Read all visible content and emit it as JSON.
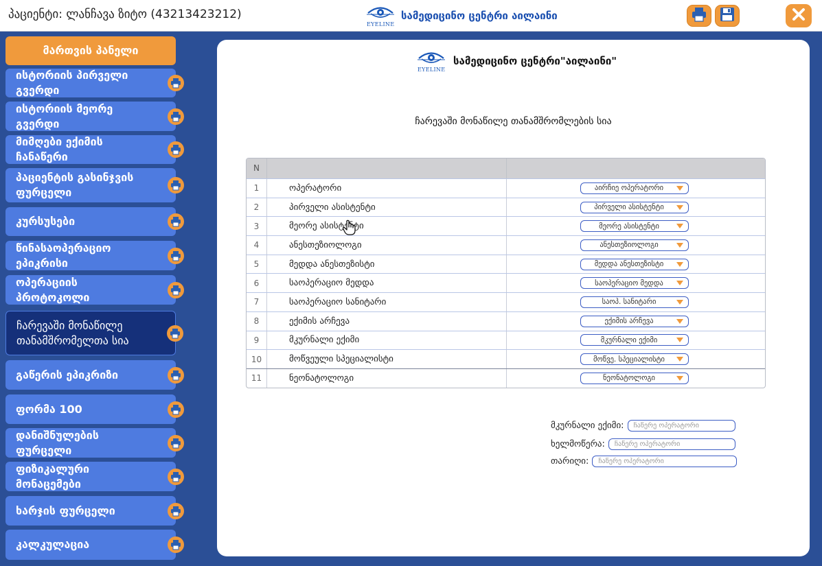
{
  "header": {
    "patient_label": "პაციენტი: ლანჩავა ზიტო (43213423212)",
    "center_name": "სამედიცინო ცენტრი აილაინი",
    "logo_text": "EYELINE"
  },
  "icons": {
    "print": "printer-icon",
    "save": "floppy-disk-icon",
    "close": "close-icon",
    "logo": "eye-logo-icon"
  },
  "colors": {
    "accent": "#f09a3c",
    "sidebar_bg": "#2b4f96",
    "sidebar_item": "#4e7be0",
    "sidebar_selected": "#15307a"
  },
  "sidebar": {
    "items": [
      {
        "label": "მართვის პანელი"
      },
      {
        "label": "ისტორიის პირველი გვერდი"
      },
      {
        "label": "ისტორიის მეორე გვერდი"
      },
      {
        "label": "მიმღები ექიმის ჩანაწერი"
      },
      {
        "label": "პაციენტის გასინჯვის ფურცელი"
      },
      {
        "label": "კურსუსები"
      },
      {
        "label": "წინასაოპერაციო ეპიკრისი"
      },
      {
        "label": "ოპერაციის პროტოკოლი"
      },
      {
        "label": "ჩარევაში მონაწილე თანამშრომელთა სია"
      },
      {
        "label": "გაწერის ეპიკრიზი"
      },
      {
        "label": "ფორმა 100"
      },
      {
        "label": "დანიშნულების ფურცელი"
      },
      {
        "label": "ფიზიკალური მონაცემები"
      },
      {
        "label": "ხარჯის ფურცელი"
      },
      {
        "label": "კალკულაცია"
      }
    ]
  },
  "document": {
    "center_name": "სამედიცინო ცენტრი\"აილაინი\"",
    "title": "ჩარევაში მონაწილე თანამშრომლების სია",
    "table": {
      "header_n": "N",
      "rows": [
        {
          "n": "1",
          "role": "ოპერატორი",
          "select": "აირჩიე ოპერატორი"
        },
        {
          "n": "2",
          "role": "პირველი ასისტენტი",
          "select": "პირველი ასისტენტი"
        },
        {
          "n": "3",
          "role": "მეორე ასისტენტი",
          "select": "მეორე ასისტენტი"
        },
        {
          "n": "4",
          "role": "ანესთეზიოლოგი",
          "select": "ანესთეზიოლოგი"
        },
        {
          "n": "5",
          "role": "მედდა ანესთეზისტი",
          "select": "მედდა ანესთეზისტი"
        },
        {
          "n": "6",
          "role": "საოპერაციო მედდა",
          "select": "საოპერაციო მედდა"
        },
        {
          "n": "7",
          "role": "საოპერაციო სანიტარი",
          "select": "საოპ. სანიტარი"
        },
        {
          "n": "8",
          "role": "ექიმის არჩევა",
          "select": "ექიმის არჩევა"
        },
        {
          "n": "9",
          "role": "მკურნალი ექიმი",
          "select": "მკურნალი ექიმი"
        },
        {
          "n": "10",
          "role": "მოწვეული სპეციალისტი",
          "select": "მოწვე. სპეციალისტი"
        },
        {
          "n": "11",
          "role": "ნეონატოლოგი",
          "select": "ნეონატოლოგი"
        }
      ]
    },
    "signatures": {
      "doctor_label": "მკურნალი ექიმი:",
      "signature_label": "ხელმოწერა:",
      "date_label": "თარიღი:",
      "placeholder": "ჩაწერე ოპერატორი"
    }
  }
}
